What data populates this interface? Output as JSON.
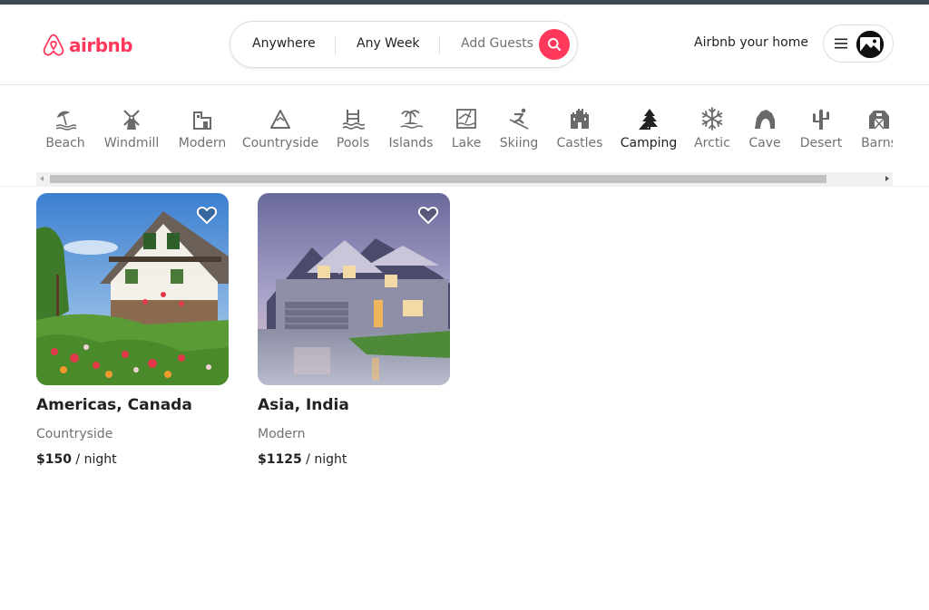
{
  "header": {
    "brand": "airbnb",
    "brand_color": "#ff385c",
    "search": {
      "where": "Anywhere",
      "when": "Any Week",
      "guests": "Add Guests"
    },
    "host_link": "Airbnb your home"
  },
  "categories": [
    {
      "label": "Beach",
      "icon": "beach-umbrella-icon"
    },
    {
      "label": "Windmill",
      "icon": "windmill-icon"
    },
    {
      "label": "Modern",
      "icon": "modern-building-icon"
    },
    {
      "label": "Countryside",
      "icon": "mountain-icon"
    },
    {
      "label": "Pools",
      "icon": "pool-icon"
    },
    {
      "label": "Islands",
      "icon": "island-icon"
    },
    {
      "label": "Lake",
      "icon": "lake-icon"
    },
    {
      "label": "Skiing",
      "icon": "skier-icon"
    },
    {
      "label": "Castles",
      "icon": "castle-icon"
    },
    {
      "label": "Camping",
      "icon": "camping-icon",
      "active": true
    },
    {
      "label": "Arctic",
      "icon": "snowflake-icon"
    },
    {
      "label": "Cave",
      "icon": "cave-icon"
    },
    {
      "label": "Desert",
      "icon": "cactus-icon"
    },
    {
      "label": "Barns",
      "icon": "barn-icon"
    }
  ],
  "listings": [
    {
      "location": "Americas, Canada",
      "category": "Countryside",
      "price": "$150",
      "unit": " / night",
      "image": "countryside cottage with flowers"
    },
    {
      "location": "Asia, India",
      "category": "Modern",
      "price": "$1125",
      "unit": " / night",
      "image": "modern suburban house at dusk"
    }
  ]
}
